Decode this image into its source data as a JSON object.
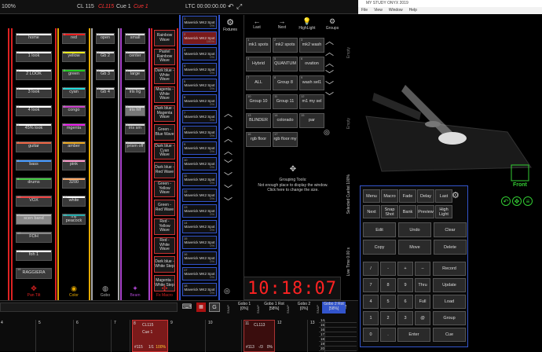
{
  "topbar": {
    "zoom": "100%",
    "cuelist": "CL 115",
    "cuelist_red": "CL115",
    "cue": "Cue 1",
    "cue_red": "Cue 1",
    "ltc": "LTC 00:00:00.00"
  },
  "columns": [
    {
      "name": "Pan Tilt",
      "items": [
        "home",
        "1 look",
        "2 LOOK",
        "3 look",
        "4 look",
        "45% look",
        "guitar",
        "bass",
        "drums",
        "VOX",
        "scen band",
        "FOH",
        "foh 1",
        "RAGGIERA"
      ]
    },
    {
      "name": "Color",
      "items": [
        "red",
        "yellow",
        "green",
        "cyan",
        "congo",
        "mgenta",
        "amber",
        "pink",
        "3200",
        "white",
        "my peacock"
      ]
    },
    {
      "name": "Gobo",
      "items": [
        "open",
        "Gb 2",
        "Gb 3",
        "Gb 4"
      ]
    },
    {
      "name": "Beam",
      "items": [
        "small",
        "center",
        "large",
        "iris lrg",
        "iris hlf",
        "iris sm",
        "prism off"
      ]
    },
    {
      "name": "Fx Macro",
      "items": [
        "Rainbow Wave",
        "Pastel Rainbow Wave",
        "Dark blue - White Wave",
        "Magenta - White Wave",
        "Dark blue - Magenta Wave",
        "Green - Blue Wave",
        "Dark blue - Cyan Wave",
        "Dark blue - Red Wave",
        "Green - Yellow Wave",
        "Green - Red Wave",
        "Red - Yellow Wave",
        "Red - White Wave",
        "Dark blue - White Step",
        "Magenta - White Step"
      ]
    }
  ],
  "fixtures": {
    "label": "Fixtures",
    "name": "Maverick MK2 Spot",
    "pct0": "0%",
    "pct100": "100%"
  },
  "groups": {
    "nav": [
      "Last",
      "Next",
      "HighLight",
      "Groups"
    ],
    "items": [
      "mk1 spots",
      "mk2 spots",
      "mk2 wash",
      "Hybrid",
      "QUANTUM",
      "ovation",
      "ALL",
      "Group 8",
      "wash sel1",
      "Group 10",
      "Group 11",
      "m1 my sel",
      "BLINDER",
      "colorado",
      "par",
      "rgb floor",
      "rgb floor my"
    ],
    "tools": "Grouping Tools:",
    "note": "Not enough place to display the window.",
    "hint": "Click here to change the size."
  },
  "clock": "10:18:07",
  "side": {
    "empty1": "Empty",
    "empty2": "Empty",
    "cuelist": "Selected Cuelist 100%",
    "live": "Live Time 0.00 s"
  },
  "viz": {
    "title": "MY STUDY ONYX 2019",
    "menu": [
      "File",
      "View",
      "Window",
      "Help"
    ],
    "front": "Front"
  },
  "keypad": {
    "top": [
      "Menu",
      "Macro",
      "Fade",
      "Delay",
      "Last",
      "Next",
      "Snap Shot",
      "Bank",
      "Preview",
      "High Light"
    ],
    "mid": [
      "Edit",
      "Undo",
      "Clear",
      "Copy",
      "Move",
      "Delete"
    ],
    "num": [
      "/",
      "-",
      "+",
      "–",
      "7",
      "8",
      "9",
      "Thru",
      "4",
      "5",
      "6",
      "Full",
      "1",
      "2",
      "3",
      "@",
      "0",
      ".",
      "Enter"
    ],
    "right": [
      "Record",
      "Update",
      "Load",
      "Group",
      "Cue"
    ]
  },
  "bottom": {
    "mid": [
      "Gobo 1",
      "Gobo 1 Rot",
      "Gobo 2",
      "Gobo 2 Rot"
    ],
    "vals": [
      "[0%]",
      "[58%]",
      "[0%]",
      "[58%]"
    ],
    "snap": "SNAP",
    "g": "G",
    "cells": [
      "4",
      "5",
      "6",
      "7",
      "8",
      "9",
      "10",
      "11",
      "12",
      "13"
    ],
    "active": {
      "cl": "CL115",
      "cue": "Cue 1",
      "num": "#115",
      "frac": "1/1",
      "pct": "100%"
    },
    "active2": {
      "cl": "CL113",
      "cue": "Cue 1",
      "num": "#113",
      "frac": "-/3",
      "pct": "0%"
    },
    "right": [
      "14",
      "15",
      "16",
      "17",
      "18",
      "19",
      "20"
    ]
  }
}
